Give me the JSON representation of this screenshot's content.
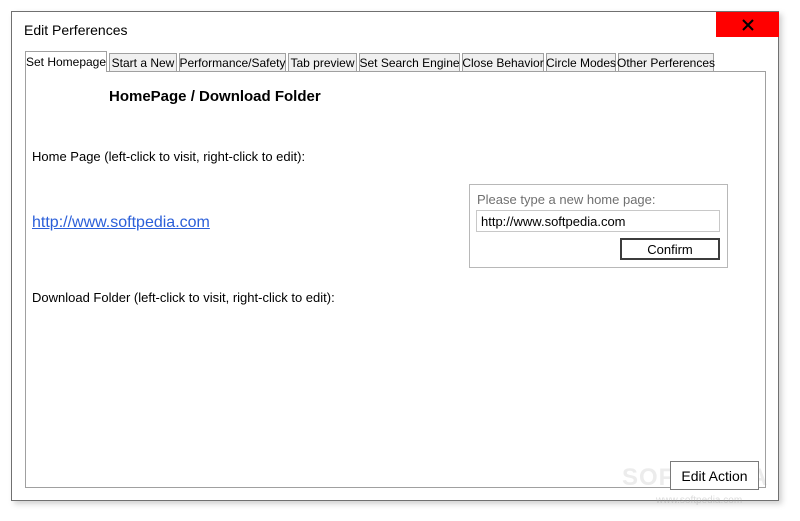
{
  "window": {
    "title": "Edit Perferences",
    "close_glyph": "✕"
  },
  "tabs": [
    {
      "label": "Set Homepage",
      "active": true
    },
    {
      "label": "Start a New",
      "active": false
    },
    {
      "label": "Performance/Safety",
      "active": false
    },
    {
      "label": "Tab preview",
      "active": false
    },
    {
      "label": "Set Search Engine",
      "active": false
    },
    {
      "label": "Close Behavior",
      "active": false
    },
    {
      "label": "Circle Modes",
      "active": false
    },
    {
      "label": "Other Perferences",
      "active": false
    }
  ],
  "panel": {
    "heading": "HomePage / Download Folder",
    "homepage_label": "Home Page (left-click to visit, right-click to edit):",
    "homepage_link": "http://www.softpedia.com",
    "download_label": "Download Folder (left-click to visit, right-click to edit):"
  },
  "popup": {
    "label": "Please type a new home page:",
    "input_value": "http://www.softpedia.com",
    "confirm_label": "Confirm"
  },
  "footer": {
    "edit_action_label": "Edit Action"
  },
  "watermark": {
    "text": "SOFTPEDIA",
    "url": "www.softpedia.com"
  },
  "colors": {
    "close_button": "#ff0000",
    "link": "#2b5fd9"
  }
}
